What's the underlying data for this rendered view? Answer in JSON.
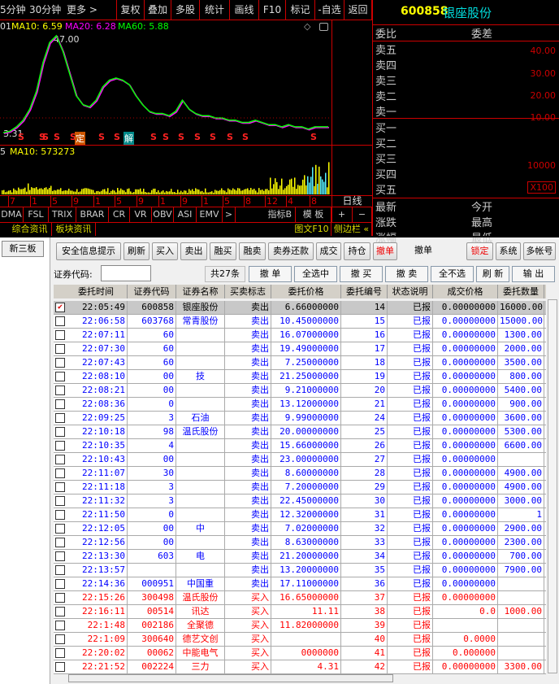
{
  "toolbar": {
    "left": [
      "5分钟",
      "30分钟",
      "更多 >"
    ],
    "buttons": [
      "复权",
      "叠加",
      "多股",
      "统计",
      "画线",
      "F10",
      "标记",
      "-自选",
      "返回"
    ]
  },
  "chart": {
    "ma_prefix": "01",
    "ma10": "MA10: 6.59",
    "ma20": "MA20: 6.28",
    "ma60": "MA60: 5.88",
    "high_label": "47.00",
    "low_label": "3.31",
    "price_axis": [
      "40.00",
      "30.00",
      "20.00",
      "10.00"
    ],
    "volume_ma_prefix": "5",
    "volume_ma10": "MA10: 573273",
    "volume_axis": [
      "10000",
      "X100"
    ],
    "dates": [
      "7",
      "1",
      "5",
      "9",
      "1",
      "5",
      "9",
      "1",
      "9",
      "1",
      "5",
      "8",
      "12",
      "4",
      "8"
    ],
    "period": "日线",
    "markers": {
      "ding": "定",
      "jie": "解",
      "s": "S"
    },
    "price_series": [
      3.3,
      4,
      6,
      9,
      14,
      22,
      35,
      44,
      47,
      40,
      30,
      20,
      16,
      15,
      18,
      24,
      27,
      28,
      27,
      25,
      20,
      16,
      13,
      12,
      12,
      11,
      13,
      18,
      14,
      12,
      11,
      11,
      10,
      10,
      9,
      9,
      8,
      8,
      9,
      8,
      7,
      7,
      6,
      7,
      6,
      6,
      5,
      6,
      6,
      6
    ]
  },
  "indicators": [
    "DMA",
    "FSL",
    "TRIX",
    "BRAR",
    "CR",
    "VR",
    "OBV",
    "ASI",
    "EMV",
    ">",
    "指标B",
    "模 板",
    "+",
    "−"
  ],
  "bottom_tabs": [
    "综合资讯",
    "板块资讯",
    "图文F10",
    "侧边栏 «"
  ],
  "quote": {
    "code": "600858",
    "name": "银座股份",
    "wei_bi": "委比",
    "wei_cha": "委差",
    "sell": [
      "卖五",
      "卖四",
      "卖三",
      "卖二",
      "卖一"
    ],
    "buy": [
      "买一",
      "买二",
      "买三",
      "买四",
      "买五"
    ],
    "stats": [
      "最新",
      "今开",
      "涨跌",
      "最高",
      "涨幅",
      "最低"
    ]
  },
  "left_nav": {
    "xinsanban": "新三板"
  },
  "trade_toolbar": [
    "安全信息提示",
    "刷新",
    "买入",
    "卖出",
    "融买",
    "融卖",
    "卖券还款",
    "成交",
    "持仓",
    "撤单",
    "撤单",
    "锁定",
    "系统",
    "多帐号"
  ],
  "filter": {
    "code_label": "证券代码:",
    "code_value": "",
    "count": "共27条",
    "buttons": [
      "撤 单",
      "全选中",
      "撤 买",
      "撤 卖",
      "全不选",
      "刷 新",
      "输 出"
    ]
  },
  "colors": {
    "sell": "#0000ff",
    "buy": "#ff0000",
    "selected": "#000000"
  },
  "table": {
    "headers": [
      "委托时间",
      "证券代码",
      "证券名称",
      "买卖标志",
      "委托价格",
      "委托编号",
      "状态说明",
      "成交价格",
      "委托数量"
    ],
    "rows": [
      [
        "22:05:49",
        "600858",
        "银座股份",
        "卖出",
        "6.66000000",
        "14",
        "已报",
        "0.00000000",
        "16000.00"
      ],
      [
        "22:06:58",
        "603768",
        "常青股份",
        "卖出",
        "10.45000000",
        "15",
        "已报",
        "0.00000000",
        "15000.00"
      ],
      [
        "22:07:11",
        "60",
        "",
        "卖出",
        "16.07000000",
        "16",
        "已报",
        "0.00000000",
        "1300.00"
      ],
      [
        "22:07:30",
        "60",
        "",
        "卖出",
        "19.49000000",
        "17",
        "已报",
        "0.00000000",
        "2000.00"
      ],
      [
        "22:07:43",
        "60",
        "",
        "卖出",
        "7.25000000",
        "18",
        "已报",
        "0.00000000",
        "3500.00"
      ],
      [
        "22:08:10",
        "00",
        "技",
        "卖出",
        "21.25000000",
        "19",
        "已报",
        "0.00000000",
        "800.00"
      ],
      [
        "22:08:21",
        "00",
        "",
        "卖出",
        "9.21000000",
        "20",
        "已报",
        "0.00000000",
        "5400.00"
      ],
      [
        "22:08:36",
        "0",
        "",
        "卖出",
        "13.12000000",
        "21",
        "已报",
        "0.00000000",
        "900.00"
      ],
      [
        "22:09:25",
        "3",
        "石油",
        "卖出",
        "9.99000000",
        "24",
        "已报",
        "0.00000000",
        "3600.00"
      ],
      [
        "22:10:18",
        "98",
        "温氏股份",
        "卖出",
        "20.00000000",
        "25",
        "已报",
        "0.00000000",
        "5300.00"
      ],
      [
        "22:10:35",
        "4",
        "",
        "卖出",
        "15.66000000",
        "26",
        "已报",
        "0.00000000",
        "6600.00"
      ],
      [
        "22:10:43",
        "00",
        "",
        "卖出",
        "23.00000000",
        "27",
        "已报",
        "0.00000000",
        ""
      ],
      [
        "22:11:07",
        "30",
        "",
        "卖出",
        "8.60000000",
        "28",
        "已报",
        "0.00000000",
        "4900.00"
      ],
      [
        "22:11:18",
        "3",
        "",
        "卖出",
        "7.20000000",
        "29",
        "已报",
        "0.00000000",
        "4900.00"
      ],
      [
        "22:11:32",
        "3",
        "",
        "卖出",
        "22.45000000",
        "30",
        "已报",
        "0.00000000",
        "3000.00"
      ],
      [
        "22:11:50",
        "0",
        "",
        "卖出",
        "12.32000000",
        "31",
        "已报",
        "0.00000000",
        "1"
      ],
      [
        "22:12:05",
        "00",
        "中",
        "卖出",
        "7.02000000",
        "32",
        "已报",
        "0.00000000",
        "2900.00"
      ],
      [
        "22:12:56",
        "00",
        "",
        "卖出",
        "8.63000000",
        "33",
        "已报",
        "0.00000000",
        "2300.00"
      ],
      [
        "22:13:30",
        "603",
        "电",
        "卖出",
        "21.20000000",
        "34",
        "已报",
        "0.00000000",
        "700.00"
      ],
      [
        "22:13:57",
        "",
        "",
        "卖出",
        "13.20000000",
        "35",
        "已报",
        "0.00000000",
        "7900.00"
      ],
      [
        "22:14:36",
        "000951",
        "中国重",
        "卖出",
        "17.11000000",
        "36",
        "已报",
        "0.00000000",
        ""
      ],
      [
        "22:15:26",
        "300498",
        "温氏股份",
        "买入",
        "16.65000000",
        "37",
        "已报",
        "0.00000000",
        ""
      ],
      [
        "22:16:11",
        "00514",
        "讯达",
        "买入",
        "11.11",
        "38",
        "已报",
        "0.0",
        "1000.00"
      ],
      [
        "22:1:48",
        "002186",
        "全聚德",
        "买入",
        "11.82000000",
        "39",
        "已报",
        "",
        ""
      ],
      [
        "22:1:09",
        "300640",
        "德艺文创",
        "买入",
        "",
        "40",
        "已报",
        "0.0000",
        ""
      ],
      [
        "22:20:02",
        "00062",
        "中能电气",
        "买入",
        "0000000",
        "41",
        "已报",
        "0.000000",
        ""
      ],
      [
        "22:21:52",
        "002224",
        "三力",
        "买入",
        "4.31",
        "42",
        "已报",
        "0.00000000",
        "3300.00"
      ]
    ]
  }
}
